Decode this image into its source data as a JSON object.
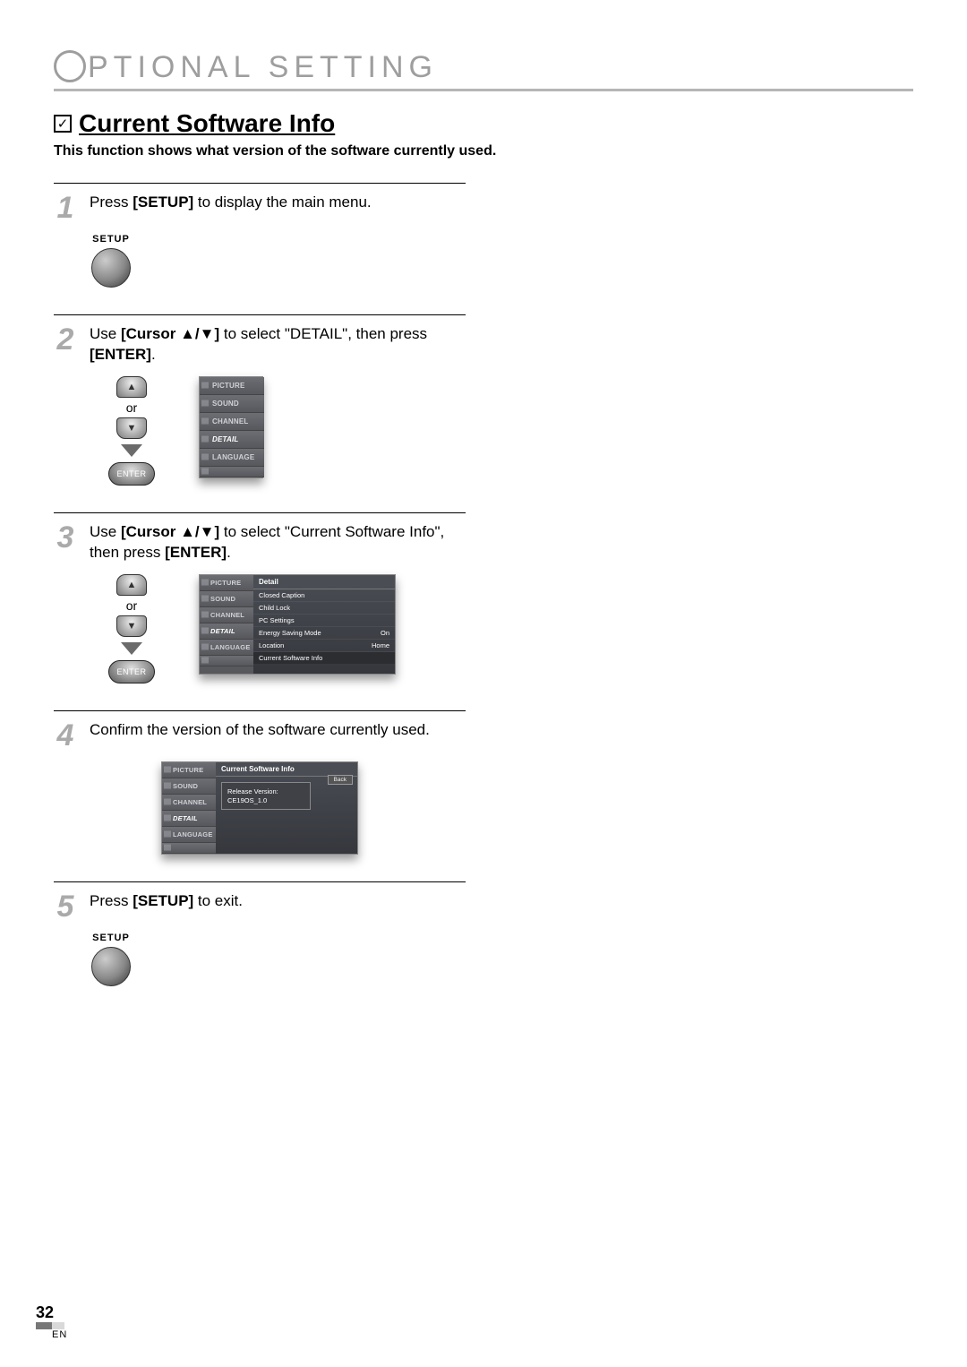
{
  "header": {
    "title_rest": "PTIONAL  SETTING"
  },
  "section": {
    "title": "Current Software Info",
    "description": "This function shows what version of the software currently used."
  },
  "steps": {
    "s1": {
      "num": "1",
      "text_pre": "Press ",
      "bold1": "[SETUP]",
      "text_post": " to display the main menu."
    },
    "s2": {
      "num": "2",
      "text_pre": "Use ",
      "bold1": "[Cursor ▲/▼]",
      "text_mid": " to select \"DETAIL\", then press ",
      "bold2": "[ENTER]",
      "text_post": "."
    },
    "s3": {
      "num": "3",
      "text_pre": "Use ",
      "bold1": "[Cursor ▲/▼]",
      "text_mid": " to select \"Current Software Info\", then press ",
      "bold2": "[ENTER]",
      "text_post": "."
    },
    "s4": {
      "num": "4",
      "text": "Confirm the version of the software currently used."
    },
    "s5": {
      "num": "5",
      "text_pre": "Press ",
      "bold1": "[SETUP]",
      "text_post": " to exit."
    }
  },
  "remote": {
    "setup_label": "SETUP",
    "or_label": "or",
    "enter_label": "ENTER"
  },
  "menu": {
    "items": {
      "picture": "PICTURE",
      "sound": "SOUND",
      "channel": "CHANNEL",
      "detail": "DETAIL",
      "language": "LANGUAGE"
    },
    "detail_panel": {
      "title": "Detail",
      "rows": [
        {
          "label": "Closed Caption",
          "value": ""
        },
        {
          "label": "Child Lock",
          "value": ""
        },
        {
          "label": "PC Settings",
          "value": ""
        },
        {
          "label": "Energy Saving Mode",
          "value": "On"
        },
        {
          "label": "Location",
          "value": "Home"
        },
        {
          "label": "Current Software Info",
          "value": ""
        }
      ]
    },
    "software_panel": {
      "title": "Current Software Info",
      "back": "Back",
      "release_label": "Release Version:",
      "release_value": "CE19OS_1.0"
    }
  },
  "footer": {
    "page": "32",
    "lang": "EN"
  }
}
